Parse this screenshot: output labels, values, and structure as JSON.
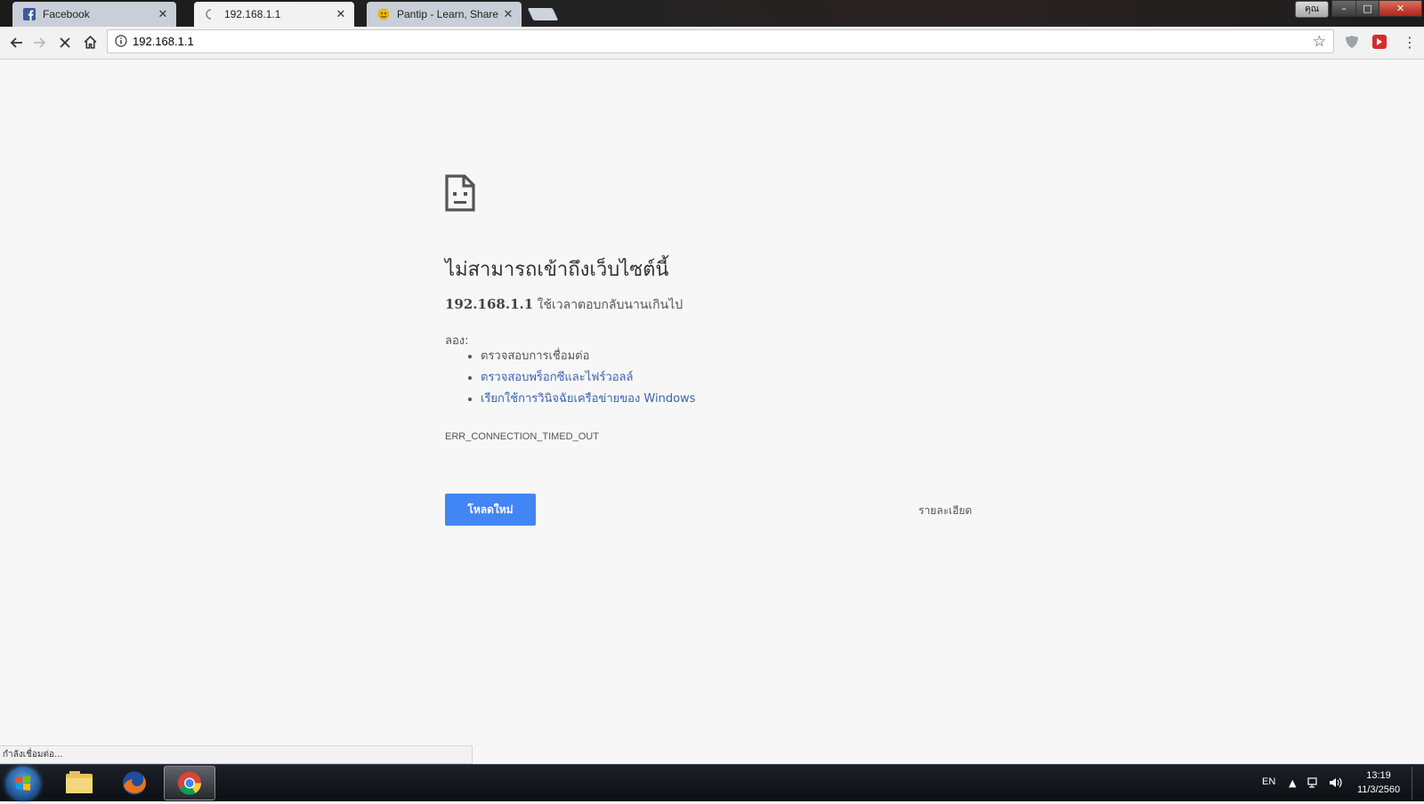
{
  "browser": {
    "tabs": [
      {
        "label": "Facebook",
        "icon": "facebook-icon",
        "active": false
      },
      {
        "label": "192.168.1.1",
        "icon": "loading-spinner-icon",
        "active": true
      },
      {
        "label": "Pantip - Learn, Share & F",
        "icon": "pantip-icon",
        "active": false
      }
    ],
    "user_button": "คุณ",
    "window_controls": {
      "minimize": "–",
      "maximize": "□",
      "close": "✕"
    },
    "address": "192.168.1.1"
  },
  "error_page": {
    "title": "ไม่สามารถเข้าถึงเว็บไซต์นี้",
    "host": "192.168.1.1",
    "description": "ใช้เวลาตอบกลับนานเกินไป",
    "try_label": "ลอง:",
    "suggestions": [
      {
        "text": "ตรวจสอบการเชื่อมต่อ",
        "link": false
      },
      {
        "text": "ตรวจสอบพร็อกซีและไฟร์วอลล์",
        "link": true
      },
      {
        "text": "เรียกใช้การวินิจฉัยเครือข่ายของ Windows",
        "link": true
      }
    ],
    "error_code": "ERR_CONNECTION_TIMED_OUT",
    "reload_label": "โหลดใหม่",
    "details_label": "รายละเอียด"
  },
  "status_text": "กำลังเชื่อมต่อ...",
  "taskbar": {
    "language": "EN",
    "time": "13:19",
    "date": "11/3/2560",
    "apps": [
      "file-explorer-icon",
      "firefox-icon",
      "chrome-icon"
    ]
  },
  "colors": {
    "reload_button": "#4285f4",
    "link": "#3a63b8",
    "page_background": "#f7f7f7"
  }
}
